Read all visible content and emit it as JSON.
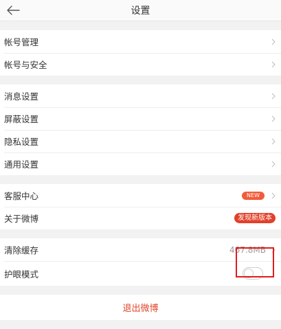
{
  "header": {
    "title": "设置"
  },
  "groups": {
    "account": {
      "items": [
        {
          "label": "帐号管理"
        },
        {
          "label": "帐号与安全"
        }
      ]
    },
    "settings": {
      "items": [
        {
          "label": "消息设置"
        },
        {
          "label": "屏蔽设置"
        },
        {
          "label": "隐私设置"
        },
        {
          "label": "通用设置"
        }
      ]
    },
    "support": {
      "items": [
        {
          "label": "客服中心",
          "badge": "NEW"
        },
        {
          "label": "关于微博",
          "badge": "发现新版本"
        }
      ]
    },
    "storage": {
      "items": [
        {
          "label": "清除缓存",
          "value": "467.8MB"
        },
        {
          "label": "护眼模式",
          "toggle_on": false
        }
      ]
    }
  },
  "logout": {
    "label": "退出微博"
  },
  "colors": {
    "accent": "#e0452a",
    "badge_new": "#f25b3a",
    "highlight": "#e21b1b"
  }
}
